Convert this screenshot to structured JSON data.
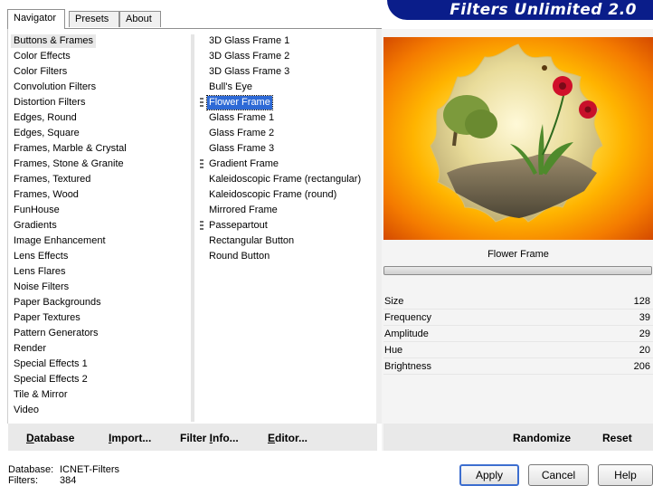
{
  "app": {
    "title": "Filters Unlimited 2.0"
  },
  "tabs": [
    {
      "label": "Navigator",
      "active": true
    },
    {
      "label": "Presets",
      "active": false
    },
    {
      "label": "About",
      "active": false
    }
  ],
  "categories": [
    "Buttons & Frames",
    "Color Effects",
    "Color Filters",
    "Convolution Filters",
    "Distortion Filters",
    "Edges, Round",
    "Edges, Square",
    "Frames, Marble & Crystal",
    "Frames, Stone & Granite",
    "Frames, Textured",
    "Frames, Wood",
    "FunHouse",
    "Gradients",
    "Image Enhancement",
    "Lens Effects",
    "Lens Flares",
    "Noise Filters",
    "Paper Backgrounds",
    "Paper Textures",
    "Pattern Generators",
    "Render",
    "Special Effects 1",
    "Special Effects 2",
    "Tile & Mirror",
    "Video"
  ],
  "selected_category": "Buttons & Frames",
  "filters": [
    {
      "label": "3D Glass Frame 1",
      "marked": false
    },
    {
      "label": "3D Glass Frame 2",
      "marked": false
    },
    {
      "label": "3D Glass Frame 3",
      "marked": false
    },
    {
      "label": "Bull's Eye",
      "marked": false
    },
    {
      "label": "Flower Frame",
      "marked": true
    },
    {
      "label": "Glass Frame 1",
      "marked": false
    },
    {
      "label": "Glass Frame 2",
      "marked": false
    },
    {
      "label": "Glass Frame 3",
      "marked": false
    },
    {
      "label": "Gradient Frame",
      "marked": true
    },
    {
      "label": "Kaleidoscopic Frame (rectangular)",
      "marked": false
    },
    {
      "label": "Kaleidoscopic Frame (round)",
      "marked": false
    },
    {
      "label": "Mirrored Frame",
      "marked": false
    },
    {
      "label": "Passepartout",
      "marked": true
    },
    {
      "label": "Rectangular Button",
      "marked": false
    },
    {
      "label": "Round Button",
      "marked": false
    }
  ],
  "selected_filter": "Flower Frame",
  "preview": {
    "filter_name": "Flower Frame"
  },
  "parameters": [
    {
      "name": "Size",
      "value": "128"
    },
    {
      "name": "Frequency",
      "value": "39"
    },
    {
      "name": "Amplitude",
      "value": "29"
    },
    {
      "name": "Hue",
      "value": "20"
    },
    {
      "name": "Brightness",
      "value": "206"
    }
  ],
  "left_buttons": {
    "database": {
      "label": "Database",
      "accel": "D"
    },
    "import": {
      "label": "Import...",
      "accel": "I"
    },
    "filter_info": {
      "label": "Filter Info...",
      "accel": "I"
    },
    "editor": {
      "label": "Editor...",
      "accel": "E"
    }
  },
  "right_buttons": {
    "randomize": "Randomize",
    "reset": "Reset"
  },
  "footer": {
    "database_label": "Database:",
    "database_value": "ICNET-Filters",
    "filters_label": "Filters:",
    "filters_value": "384"
  },
  "dialog_buttons": {
    "apply": "Apply",
    "cancel": "Cancel",
    "help": "Help"
  },
  "colors": {
    "banner": "#0a1d8a",
    "selection": "#2e6ad6",
    "default_button_border": "#3d6ecf"
  }
}
